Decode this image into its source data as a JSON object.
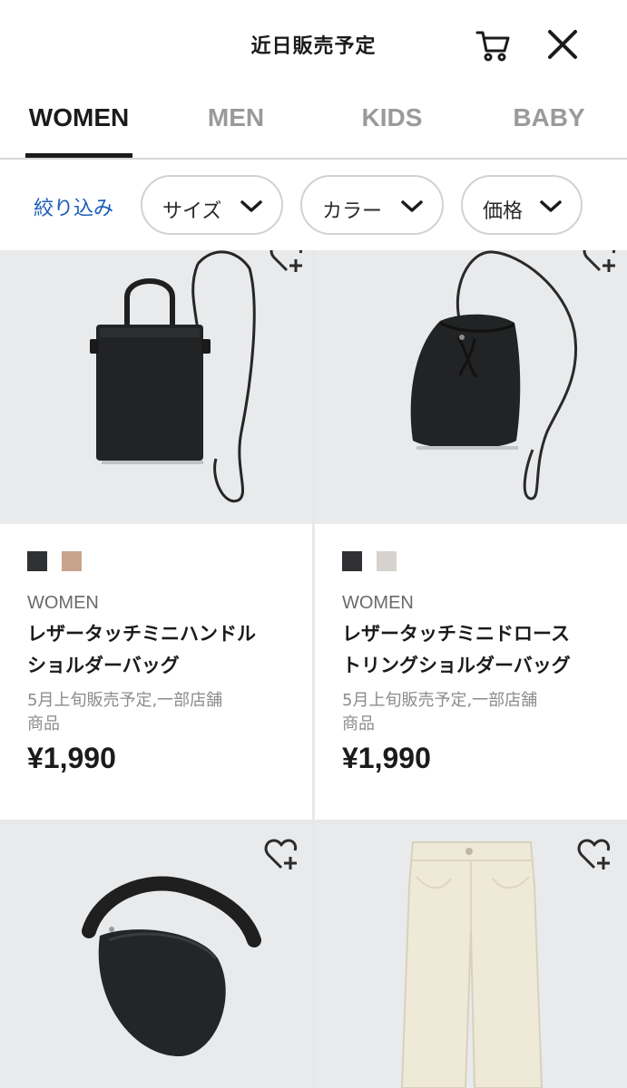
{
  "header": {
    "title": "近日販売予定",
    "cart_icon": "cart-icon",
    "close_icon": "close-icon"
  },
  "tabs": [
    {
      "label": "WOMEN",
      "active": true
    },
    {
      "label": "MEN",
      "active": false
    },
    {
      "label": "KIDS",
      "active": false
    },
    {
      "label": "BABY",
      "active": false
    }
  ],
  "filters": {
    "refine_label": "絞り込み",
    "size_label": "サイズ",
    "color_label": "カラー",
    "price_label": "価格"
  },
  "products": [
    {
      "swatches": [
        "#2f3134",
        "#c7a58c"
      ],
      "gender": "WOMEN",
      "name_line1": "レザータッチミニハンドル",
      "name_line2": "ショルダーバッグ",
      "note_line1": "5月上旬販売予定,一部店舗",
      "note_line2": "商品",
      "price": "¥1,990"
    },
    {
      "swatches": [
        "#2f3134",
        "#d6d2cd"
      ],
      "gender": "WOMEN",
      "name_line1": "レザータッチミニドロース",
      "name_line2": "トリングショルダーバッグ",
      "note_line1": "5月上旬販売予定,一部店舗",
      "note_line2": "商品",
      "price": "¥1,990"
    }
  ],
  "colors": {
    "accent_link": "#1a5cb8",
    "active_tab": "#1b1b1b",
    "inactive_tab": "#9a9a9a"
  }
}
